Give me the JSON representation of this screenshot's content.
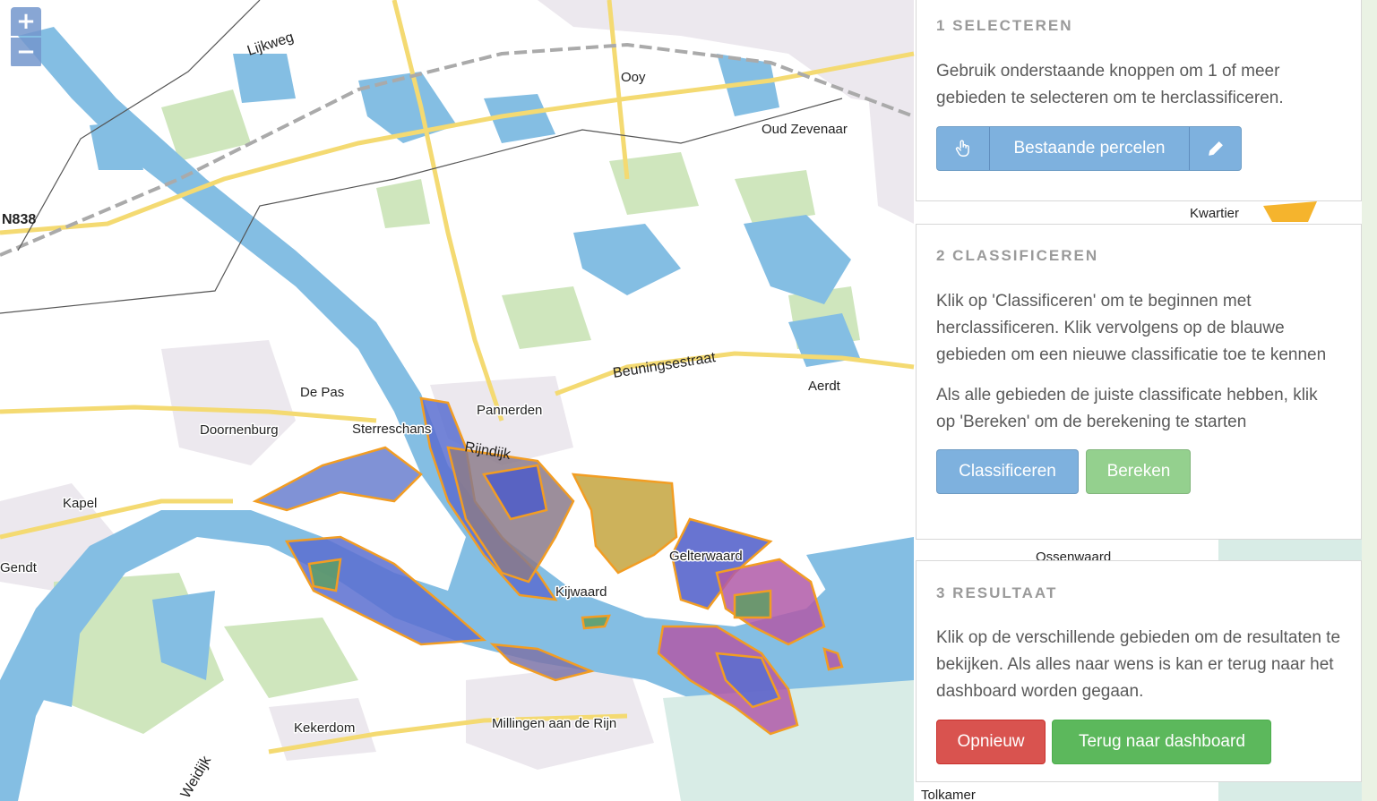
{
  "zoom": {
    "in_label": "+",
    "out_label": "−"
  },
  "map": {
    "labels": [
      "Lijkweg",
      "Ooy",
      "Oud Zevenaar",
      "N838",
      "Kwartier",
      "Beuningsestraat",
      "Aerdt",
      "De Pas",
      "Pannerden",
      "Doornenburg",
      "Sterreschans",
      "Rijndijk",
      "Kapel",
      "Gendt",
      "Gelterwaard",
      "Kijwaard",
      "Ossenwaard",
      "Kekerdom",
      "Millingen aan de Rijn",
      "Tolkamer",
      "Weidijk"
    ],
    "colors": {
      "water": "#84bee3",
      "land": "#ffffff",
      "green": "#c6e2b1",
      "urban": "#ebe6ec",
      "road_yellow": "#f4da72",
      "parcel_outline": "#f29d23",
      "parcel_blue": "#5a6fd0",
      "parcel_brown": "#8b7a8a",
      "parcel_olive": "#c4a43e",
      "parcel_green": "#5e9e63",
      "parcel_magenta": "#b05aa8"
    }
  },
  "panel1": {
    "title": "1 SELECTEREN",
    "text": "Gebruik onderstaande knoppen om 1 of meer gebieden te selecteren om te herclassificeren.",
    "buttons": {
      "select_icon": "hand-pointer-icon",
      "existing_label": "Bestaande percelen",
      "draw_icon": "pencil-icon"
    }
  },
  "panel2": {
    "title": "2 CLASSIFICEREN",
    "text1": "Klik op 'Classificeren' om te beginnen met herclassificeren. Klik vervolgens op de blauwe gebieden om een nieuwe classificatie toe te kennen",
    "text2": "Als alle gebieden de juiste classificate hebben, klik op 'Bereken' om de berekening te starten",
    "classify_label": "Classificeren",
    "calculate_label": "Bereken"
  },
  "panel3": {
    "title": "3 RESULTAAT",
    "text": "Klik op de verschillende gebieden om de resultaten te bekijken. Als alles naar wens is kan er terug naar het dashboard worden gegaan.",
    "reset_label": "Opnieuw",
    "back_label": "Terug naar dashboard"
  }
}
